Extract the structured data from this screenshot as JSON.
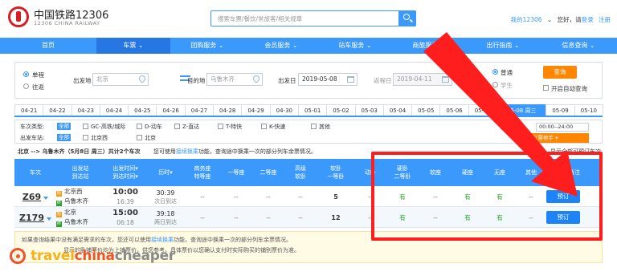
{
  "header": {
    "brand_cn": "中国铁路12306",
    "brand_en": "12306 CHINA RAILWAY",
    "search_placeholder": "搜索车票/餐饮/常旅客/相关规章",
    "my_account": "我的12306",
    "greeting": "您好，请",
    "login": "登录",
    "register": "注册"
  },
  "nav": {
    "items": [
      {
        "label": "首页"
      },
      {
        "label": "车票 ⌄"
      },
      {
        "label": "团购服务 ⌄"
      },
      {
        "label": "会员服务 ⌄"
      },
      {
        "label": "站车服务 ⌄"
      },
      {
        "label": "商旅服务 ⌄"
      },
      {
        "label": "出行指南 ⌄"
      },
      {
        "label": "信息查询 ⌄"
      }
    ]
  },
  "query": {
    "trip_one_way": "单程",
    "trip_round": "往返",
    "from_label": "出发地",
    "from_value": "北京",
    "to_label": "目的地",
    "to_value": "乌鲁木齐",
    "depart_label": "出发日",
    "depart_value": "2019-05-08",
    "return_label": "返程日",
    "return_value": "2019-04-11",
    "ticket_normal": "普通",
    "ticket_student": "学生",
    "search_button": "查询",
    "auto_query": "开启自动查询"
  },
  "dates": [
    "04-21",
    "04-22",
    "04-23",
    "04-24",
    "04-25",
    "04-26",
    "04-27",
    "04-28",
    "04-29",
    "04-30",
    "05-01",
    "05-02",
    "05-03",
    "05-04",
    "05-05",
    "05-06",
    "05-07",
    "05-08 周三",
    "05-09",
    "05-10"
  ],
  "active_date_index": 17,
  "filters": {
    "type_label": "车次类型:",
    "all_chip": "全部",
    "types": [
      "GC-高铁/城际",
      "D-动车",
      "Z-直达",
      "T-特快",
      "K-快速",
      "其他"
    ],
    "station_label": "出发车站:",
    "stations": [
      "北京西",
      "北京"
    ],
    "depart_time_label": "发车时间:",
    "depart_time_value": "00:00--24:00",
    "order_help": "订票帮手 ▾"
  },
  "summary": {
    "route": "北京 --> 乌鲁木齐（5月8日 周三）共计2个车次",
    "hint_pre": "您可使用",
    "hint_link": "接续换乘",
    "hint_post": "功能，查询途中换乘一次的部分列车余票情况。",
    "right": "显示全部可预订车次"
  },
  "table": {
    "headers": [
      {
        "l1": "车次",
        "l2": ""
      },
      {
        "l1": "出发站",
        "l2": "到达站"
      },
      {
        "l1": "出发时间▾",
        "l2": "到达时间▾"
      },
      {
        "l1": "历时▾",
        "l2": ""
      },
      {
        "l1": "商务座",
        "l2": "特等座"
      },
      {
        "l1": "一等座",
        "l2": ""
      },
      {
        "l1": "二等座",
        "l2": ""
      },
      {
        "l1": "高级",
        "l2": "软卧"
      },
      {
        "l1": "软卧",
        "l2": "一等卧"
      },
      {
        "l1": "动卧",
        "l2": ""
      },
      {
        "l1": "硬卧",
        "l2": "二等卧"
      },
      {
        "l1": "软座",
        "l2": ""
      },
      {
        "l1": "硬座",
        "l2": ""
      },
      {
        "l1": "无座",
        "l2": ""
      },
      {
        "l1": "其他",
        "l2": ""
      },
      {
        "l1": "备注",
        "l2": ""
      }
    ],
    "rows": [
      {
        "train": "Z69",
        "from": "北京西",
        "to": "乌鲁木齐",
        "dep": "10:00",
        "arr": "16:39",
        "dur": "30:39",
        "dur_sub": "次日到达",
        "cells": [
          "--",
          "--",
          "--",
          "--",
          "5",
          "--",
          "有",
          "--",
          "有",
          "有",
          "--"
        ],
        "book": "预订"
      },
      {
        "train": "Z179",
        "from": "北京",
        "to": "乌鲁木齐",
        "dep": "15:00",
        "arr": "06:18",
        "dur": "39:18",
        "dur_sub": "两日到达",
        "cells": [
          "--",
          "--",
          "--",
          "--",
          "12",
          "--",
          "有",
          "--",
          "有",
          "有",
          "--"
        ],
        "book": "预订"
      }
    ]
  },
  "notice": {
    "line1_pre": "如果查询结果中没有满足需求的车次，您还可以使用",
    "line1_link": "接续换乘",
    "line1_post": "功能，查询途中换乘一次的部分列车余票情况。",
    "line2": "显示的卧铺票价均为上铺票价，供您参考。具体票价以您确认支付时实际购买的铺别票价为准。"
  },
  "watermark": {
    "part1": "travel",
    "part2": "china",
    "part3": "cheaper"
  },
  "colors": {
    "brand_blue": "#3b99fc",
    "nav_active": "#2676e3",
    "accent_orange": "#ff8600",
    "annotation_red": "#ff1e1e",
    "available_green": "#2aa12a"
  }
}
